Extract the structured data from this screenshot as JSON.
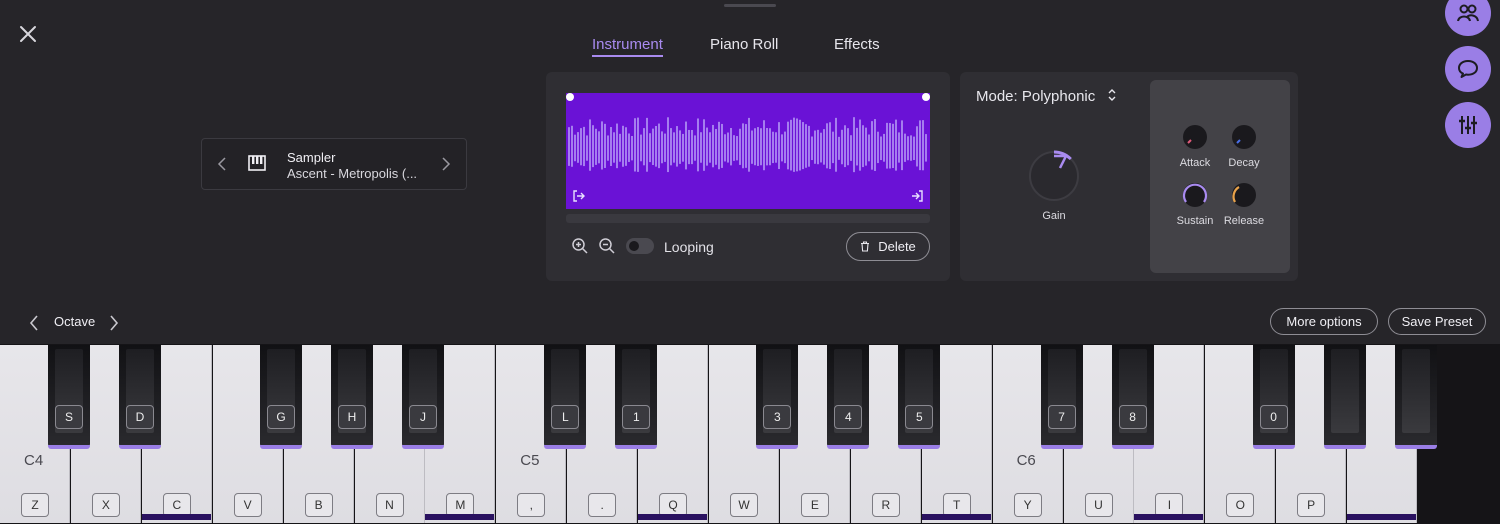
{
  "tabs": [
    {
      "label": "Instrument",
      "active": true
    },
    {
      "label": "Piano Roll",
      "active": false
    },
    {
      "label": "Effects",
      "active": false
    }
  ],
  "instrument": {
    "type": "Sampler",
    "preset": "Ascent - Metropolis (..."
  },
  "sampler": {
    "looping_label": "Looping",
    "looping_on": false,
    "delete_label": "Delete"
  },
  "mode": {
    "label": "Mode: Polyphonic"
  },
  "gain": {
    "label": "Gain"
  },
  "envelope": {
    "attack": "Attack",
    "decay": "Decay",
    "sustain": "Sustain",
    "release": "Release"
  },
  "octave": {
    "label": "Octave"
  },
  "buttons": {
    "more_options": "More options",
    "save_preset": "Save Preset"
  },
  "octave_labels": [
    "C4",
    "C5",
    "C6"
  ],
  "white_keys": [
    "Z",
    "X",
    "C",
    "V",
    "B",
    "N",
    "M",
    ",",
    ".",
    "Q",
    "W",
    "E",
    "R",
    "T",
    "Y",
    "U",
    "I",
    "O",
    "P",
    ""
  ],
  "black_keys": [
    "S",
    "D",
    "G",
    "H",
    "J",
    "L",
    "1",
    "3",
    "4",
    "5",
    "7",
    "8",
    "0",
    "",
    ""
  ],
  "colors": {
    "accent": "#a98bf0",
    "waveform_bg": "#6a12d6",
    "side_button": "#9a7ee6"
  },
  "icons": [
    "close-icon",
    "collaborators-icon",
    "chat-icon",
    "mixer-icon",
    "piano-icon",
    "zoom-in-icon",
    "zoom-out-icon",
    "trash-icon",
    "chevron-left-icon",
    "chevron-right-icon",
    "sort-icon"
  ]
}
